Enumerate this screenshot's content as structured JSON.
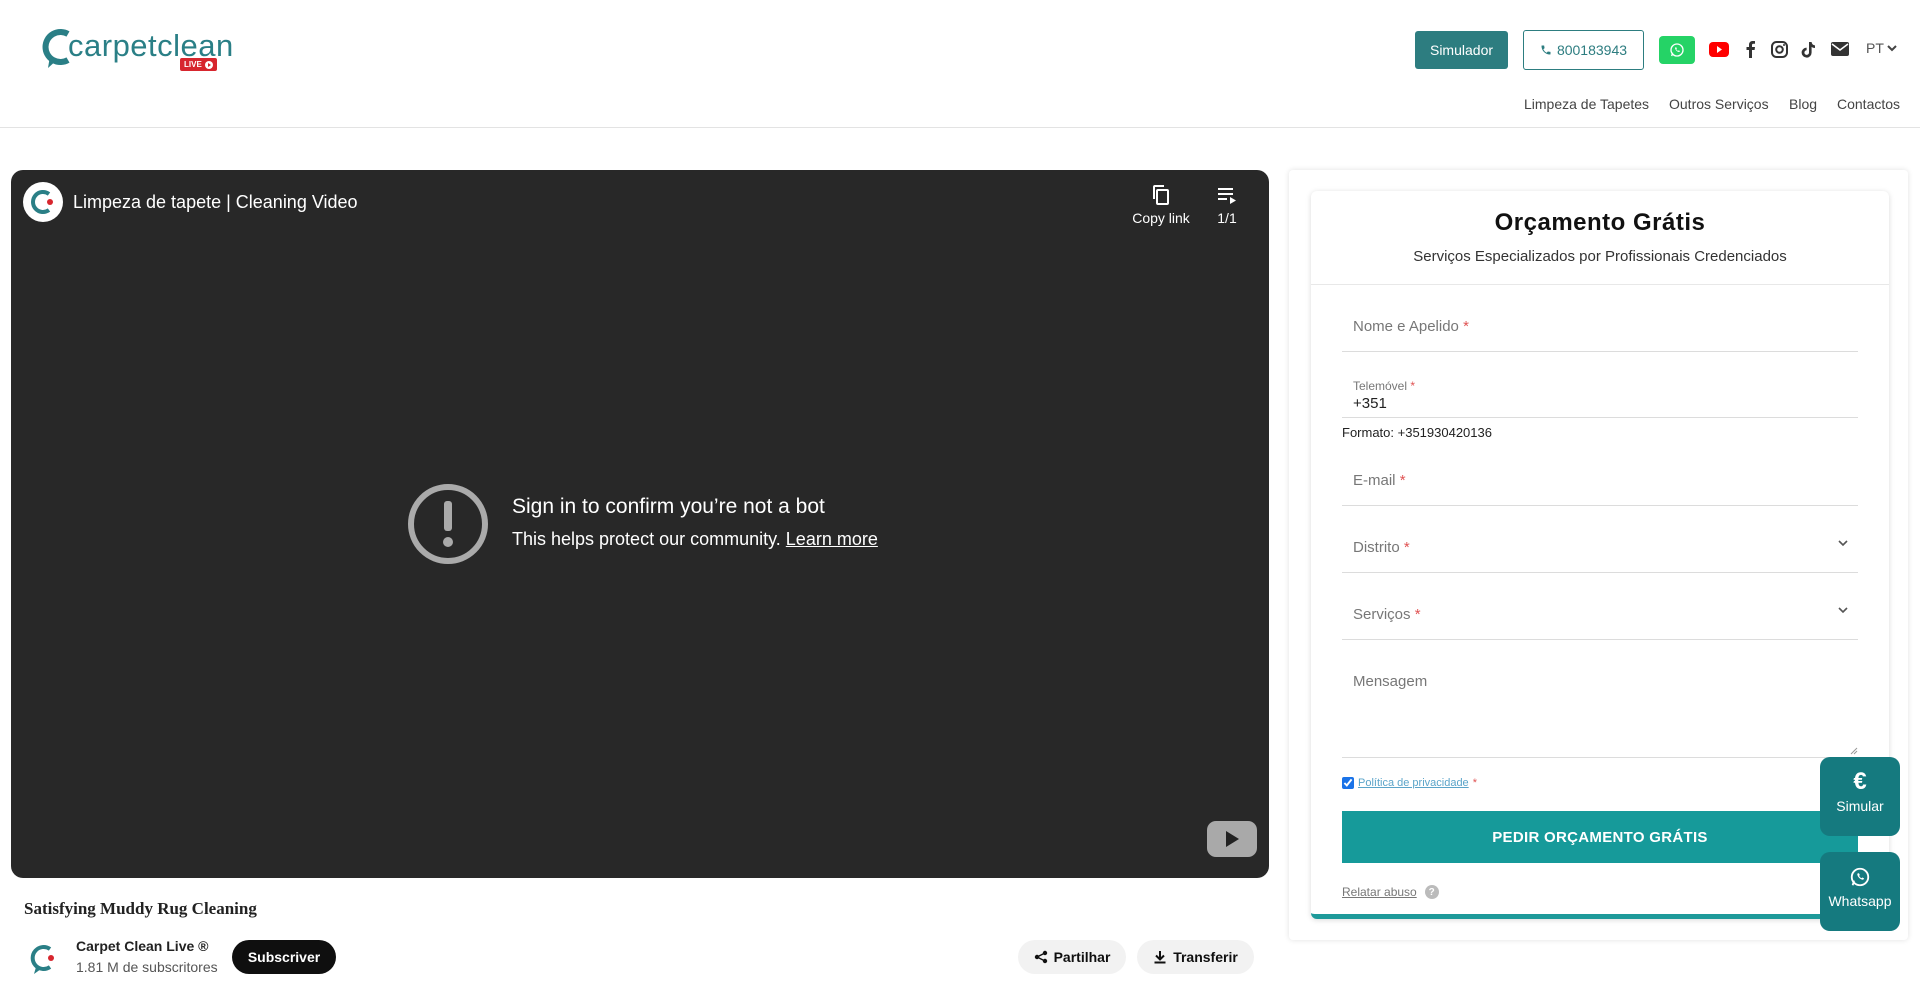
{
  "header": {
    "logo": {
      "text": "carpetclean",
      "badge": "LIVE"
    },
    "simulator_label": "Simulador",
    "phone_label": "800183943",
    "language": "PT",
    "social_icons": [
      "youtube-icon",
      "facebook-icon",
      "instagram-icon",
      "tiktok-icon",
      "email-icon"
    ],
    "nav": [
      "Limpeza de Tapetes",
      "Outros Serviços",
      "Blog",
      "Contactos"
    ]
  },
  "video": {
    "title": "Limpeza de tapete | Cleaning Video",
    "copy_link": "Copy link",
    "playlist_count": "1/1",
    "error_title": "Sign in to confirm you’re not a bot",
    "error_text": "This helps protect our community.",
    "error_link": "Learn more"
  },
  "below_video": {
    "title": "Satisfying Muddy Rug Cleaning",
    "channel_name": "Carpet Clean Live ®",
    "subscribers": "1.81 M de subscritores",
    "subscribe": "Subscriver",
    "share": "Partilhar",
    "download": "Transferir"
  },
  "form": {
    "title": "Orçamento Grátis",
    "subtitle": "Serviços Especializados por Profissionais Credenciados",
    "name_label": "Nome e Apelido",
    "phone_label": "Telemóvel",
    "phone_value": "+351",
    "phone_format": "Formato: +351930420136",
    "email_label": "E-mail",
    "district_label": "Distrito",
    "services_label": "Serviços",
    "message_placeholder": "Mensagem",
    "required_mark": "*",
    "privacy_label": "Política de privacidade",
    "privacy_checked": true,
    "submit_label": "PEDIR ORÇAMENTO GRÁTIS",
    "report_abuse": "Relatar abuso",
    "help_mark": "?"
  },
  "floating": {
    "simulate_label": "Simular",
    "simulate_icon": "€",
    "whatsapp_label": "Whatsapp"
  },
  "colors": {
    "brand_teal": "#2d7d80",
    "button_teal": "#169a9a",
    "whatsapp_green": "#25d366",
    "youtube_red": "#ff0000",
    "required_red": "#e05353"
  }
}
